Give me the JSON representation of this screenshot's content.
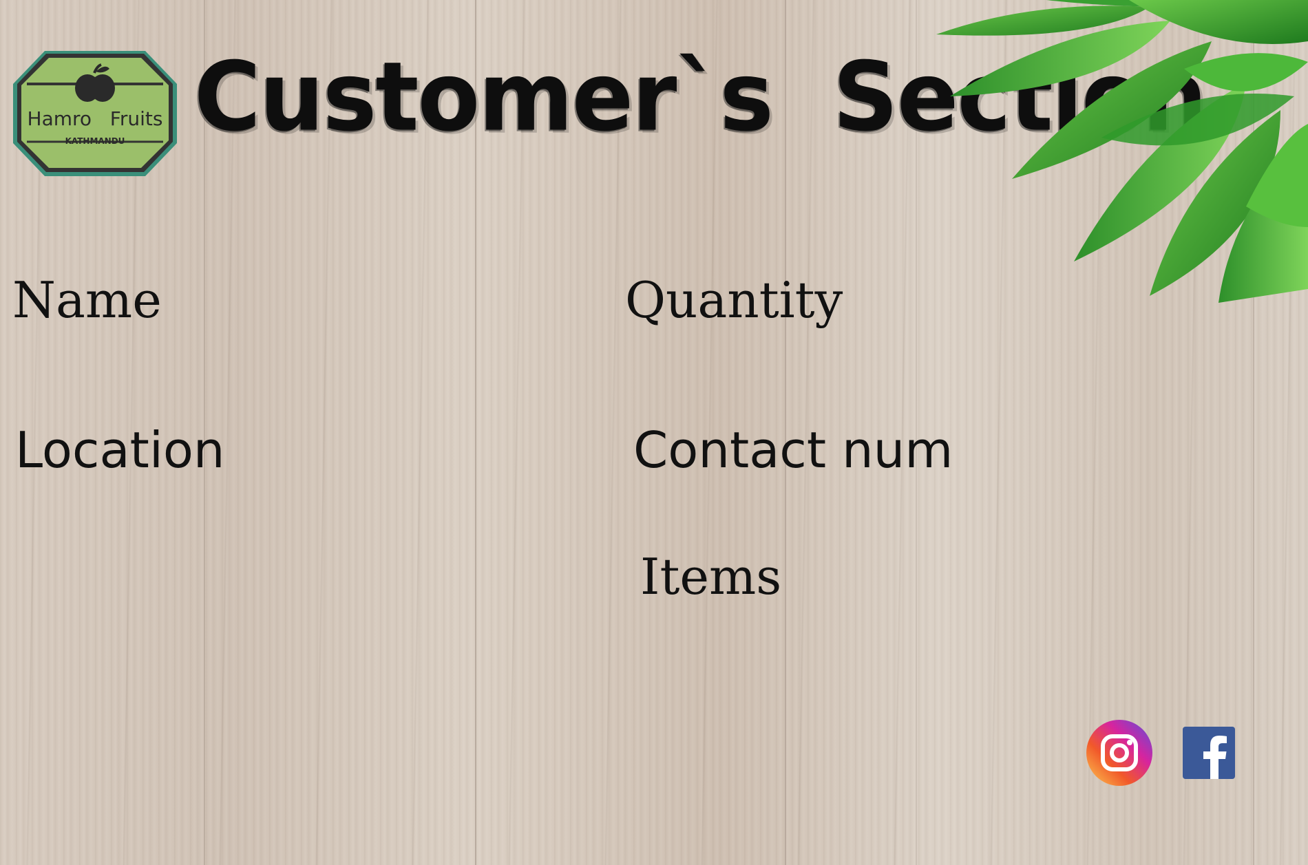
{
  "logo": {
    "brand": "Hamro   Fruits",
    "city": "KATHMANDU",
    "brand_color": "#9bbf6a"
  },
  "header": {
    "title": "Customer`s  Section"
  },
  "form": {
    "name_label": "Name",
    "quantity_label": "Quantity",
    "location_label": "Location",
    "contact_label": "Contact num",
    "items_label": "Items"
  },
  "social": {
    "instagram": "instagram-icon",
    "facebook": "facebook-icon"
  },
  "colors": {
    "leaf": "#3fa52f",
    "facebook": "#3b5998",
    "text": "#111111"
  }
}
